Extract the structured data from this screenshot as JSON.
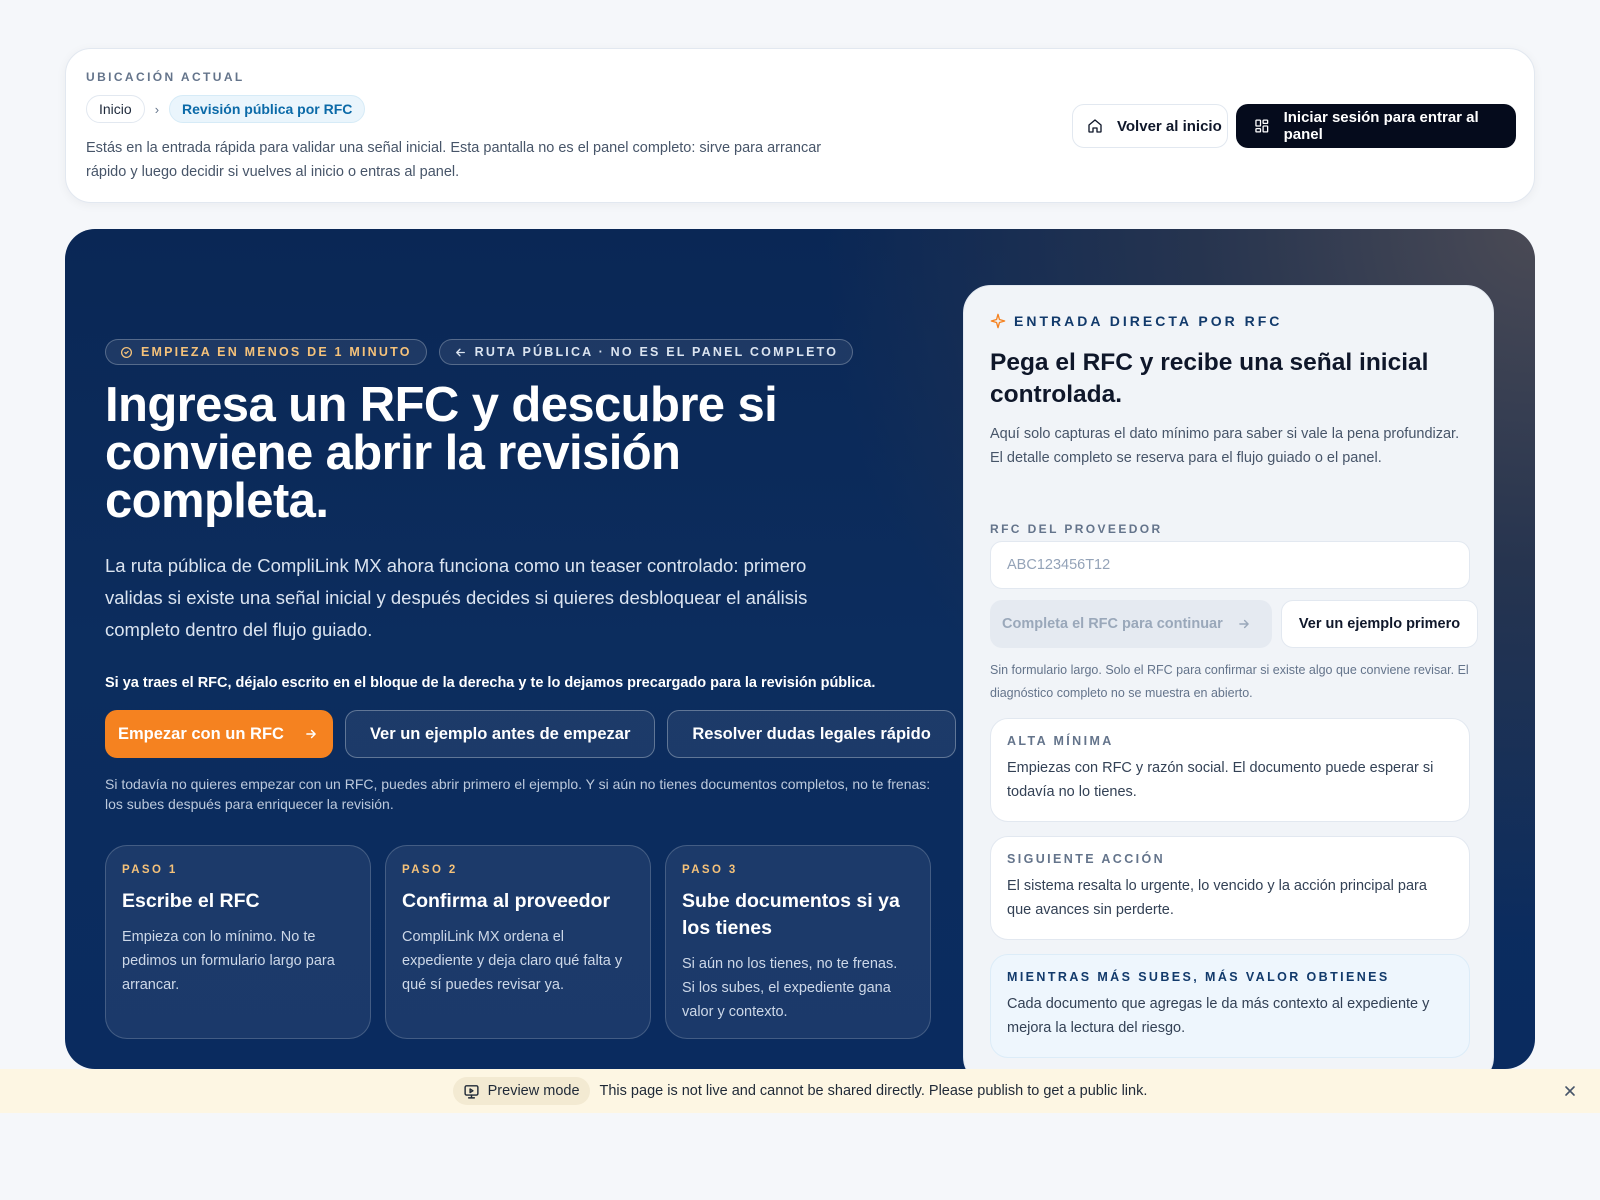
{
  "location": {
    "eyebrow": "UBICACIÓN ACTUAL",
    "crumbs": [
      "Inicio",
      "Revisión pública por RFC"
    ],
    "crumb_separator": "›",
    "description": "Estás en la entrada rápida para validar una señal inicial. Esta pantalla no es el panel completo: sirve para arrancar rápido y luego decidir si vuelves al inicio o entras al panel.",
    "home_button": "Volver al inicio",
    "login_button": "Iniciar sesión para entrar al panel"
  },
  "hero": {
    "pill_time": "EMPIEZA EN MENOS DE 1 MINUTO",
    "pill_route": "RUTA PÚBLICA · NO ES EL PANEL COMPLETO",
    "title": "Ingresa un RFC y descubre si conviene abrir la revisión completa.",
    "lead": "La ruta pública de CompliLink MX ahora funciona como un teaser controlado: primero validas si existe una señal inicial y después decides si quieres desbloquear el análisis completo dentro del flujo guiado.",
    "note": "Si ya traes el RFC, déjalo escrito en el bloque de la derecha y te lo dejamos precargado para la revisión pública.",
    "cta_primary": "Empezar con un RFC",
    "cta_example": "Ver un ejemplo antes de empezar",
    "cta_legal": "Resolver dudas legales rápido",
    "hint": "Si todavía no quieres empezar con un RFC, puedes abrir primero el ejemplo. Y si aún no tienes documentos completos, no te frenas: los subes después para enriquecer la revisión.",
    "steps": [
      {
        "kicker": "PASO 1",
        "title": "Escribe el RFC",
        "desc": "Empieza con lo mínimo. No te pedimos un formulario largo para arrancar."
      },
      {
        "kicker": "PASO 2",
        "title": "Confirma al proveedor",
        "desc": "CompliLink MX ordena el expediente y deja claro qué falta y qué sí puedes revisar ya."
      },
      {
        "kicker": "PASO 3",
        "title": "Sube documentos si ya los tienes",
        "desc": "Si aún no los tienes, no te frenas. Si los subes, el expediente gana valor y contexto."
      }
    ]
  },
  "form": {
    "eyebrow": "ENTRADA DIRECTA POR RFC",
    "title": "Pega el RFC y recibe una señal inicial controlada.",
    "desc": "Aquí solo capturas el dato mínimo para saber si vale la pena profundizar. El detalle completo se reserva para el flujo guiado o el panel.",
    "label": "RFC DEL PROVEEDOR",
    "placeholder": "ABC123456T12",
    "continue_button": "Completa el RFC para continuar",
    "example_button": "Ver un ejemplo primero",
    "small": "Sin formulario largo. Solo el RFC para confirmar si existe algo que conviene revisar. El diagnóstico completo no se muestra en abierto.",
    "cards": [
      {
        "kicker": "ALTA MÍNIMA",
        "desc": "Empiezas con RFC y razón social. El documento puede esperar si todavía no lo tienes."
      },
      {
        "kicker": "SIGUIENTE ACCIÓN",
        "desc": "El sistema resalta lo urgente, lo vencido y la acción principal para que avances sin perderte."
      },
      {
        "kicker": "MIENTRAS MÁS SUBES, MÁS VALOR OBTIENES",
        "desc": "Cada documento que agregas le da más contexto al expediente y mejora la lectura del riesgo."
      }
    ]
  },
  "preview": {
    "tag": "Preview mode",
    "message": "This page is not live and cannot be shared directly. Please publish to get a public link."
  },
  "colors": {
    "accent_orange": "#f58220",
    "hero_navy": "#0a2755",
    "dark_button": "#050b1c",
    "link_blue": "#0b6aa8"
  },
  "icons": {
    "home": "home-icon",
    "panel": "grid-icon",
    "clock": "clock-icon",
    "back": "arrow-left-icon",
    "arrow": "arrow-right-icon",
    "sparkle": "sparkle-icon",
    "preview": "monitor-play-icon",
    "close": "close-icon"
  }
}
